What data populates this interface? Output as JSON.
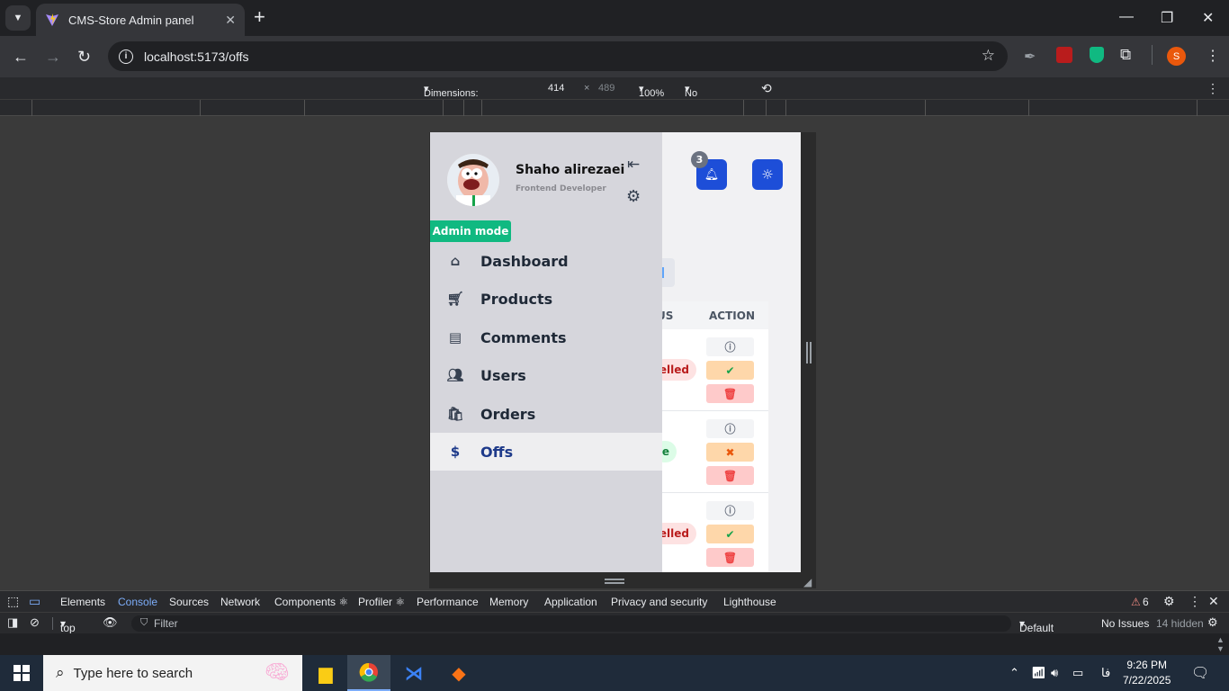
{
  "browser": {
    "tab_title": "CMS-Store Admin panel",
    "tab_close": "✕",
    "new_tab": "+",
    "url_host": "localhost",
    "url_rest": ":5173/offs",
    "profile_initial": "S"
  },
  "device_toolbar": {
    "dimensions_label": "Dimensions: Responsive",
    "width": "414",
    "times": "×",
    "height": "489",
    "zoom": "100%",
    "throttling": "No throttling"
  },
  "app": {
    "notification_count": "3",
    "user": {
      "name": "Shaho alirezaei",
      "role": "Frontend Developer"
    },
    "admin_badge": "Admin mode",
    "nav": [
      {
        "label": "Dashboard",
        "icon": "home-icon"
      },
      {
        "label": "Products",
        "icon": "cart-icon"
      },
      {
        "label": "Comments",
        "icon": "comment-icon"
      },
      {
        "label": "Users",
        "icon": "users-icon"
      },
      {
        "label": "Orders",
        "icon": "bag-icon"
      },
      {
        "label": "Offs",
        "icon": "dollar-icon",
        "active": true
      }
    ],
    "table": {
      "col_status": "US",
      "col_action": "ACTION",
      "rows": [
        {
          "status": "elled",
          "status_kind": "cancelled",
          "toggle": "check"
        },
        {
          "status": "ve",
          "status_kind": "active",
          "toggle": "cross"
        },
        {
          "status": "elled",
          "status_kind": "cancelled",
          "toggle": "check"
        }
      ]
    },
    "colors": {
      "accent": "#1d4ed8",
      "admin_badge": "#10b981",
      "sidebar_bg": "#d6d6dc"
    }
  },
  "devtools": {
    "tabs": [
      "Elements",
      "Console",
      "Sources",
      "Network",
      "Components ⚛",
      "Profiler ⚛",
      "Performance",
      "Memory",
      "Application",
      "Privacy and security",
      "Lighthouse"
    ],
    "active_tab": "Console",
    "warnings": "6",
    "context": "top",
    "filter_placeholder": "Filter",
    "levels": "Default levels",
    "issues": "No Issues",
    "hidden": "14 hidden"
  },
  "taskbar": {
    "search_placeholder": "Type here to search",
    "lang": "فا",
    "time": "9:26 PM",
    "date": "7/22/2025"
  }
}
